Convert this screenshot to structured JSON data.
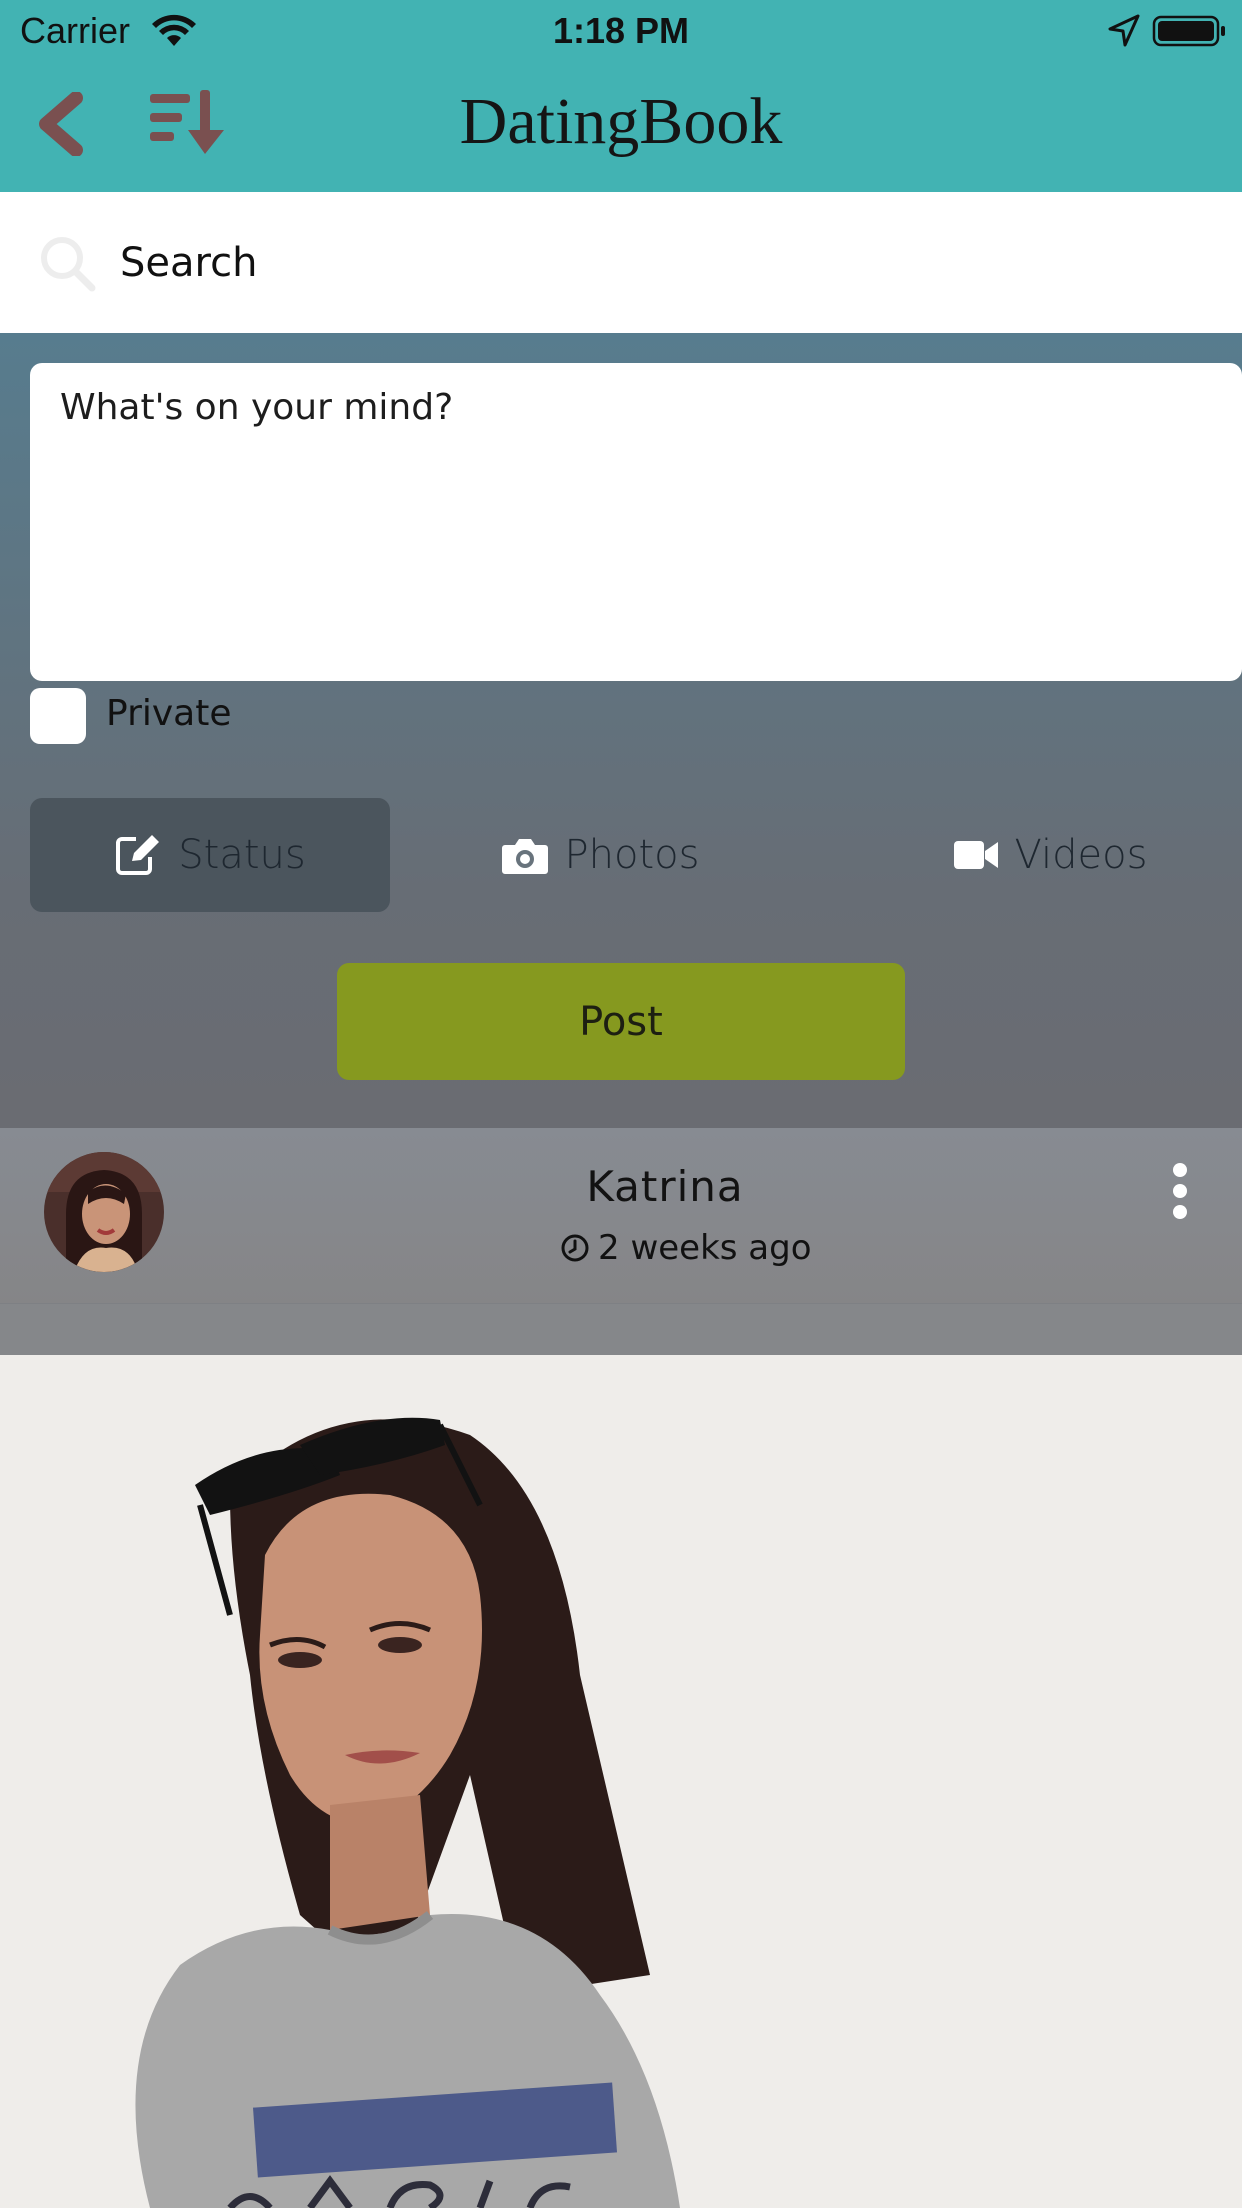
{
  "status_bar": {
    "carrier": "Carrier",
    "time": "1:18 PM"
  },
  "nav": {
    "title": "DatingBook",
    "back_icon": "chevron-left-icon",
    "sort_icon": "sort-descending-icon"
  },
  "search": {
    "placeholder": "Search",
    "icon": "search-icon"
  },
  "composer": {
    "placeholder": "What's on your mind?",
    "private_label": "Private",
    "private_checked": false,
    "tabs": [
      {
        "label": "Status",
        "icon": "edit-icon",
        "selected": true
      },
      {
        "label": "Photos",
        "icon": "camera-icon",
        "selected": false
      },
      {
        "label": "Videos",
        "icon": "video-camera-icon",
        "selected": false
      }
    ],
    "post_label": "Post"
  },
  "post": {
    "author": "Katrina",
    "time_ago": "2 weeks ago",
    "time_icon": "clock-icon",
    "more_icon": "more-vertical-icon"
  },
  "colors": {
    "header_bg": "#42b3b3",
    "nav_icon": "#7a5050",
    "post_button": "#86991f",
    "selected_tab": "#4b555d"
  }
}
